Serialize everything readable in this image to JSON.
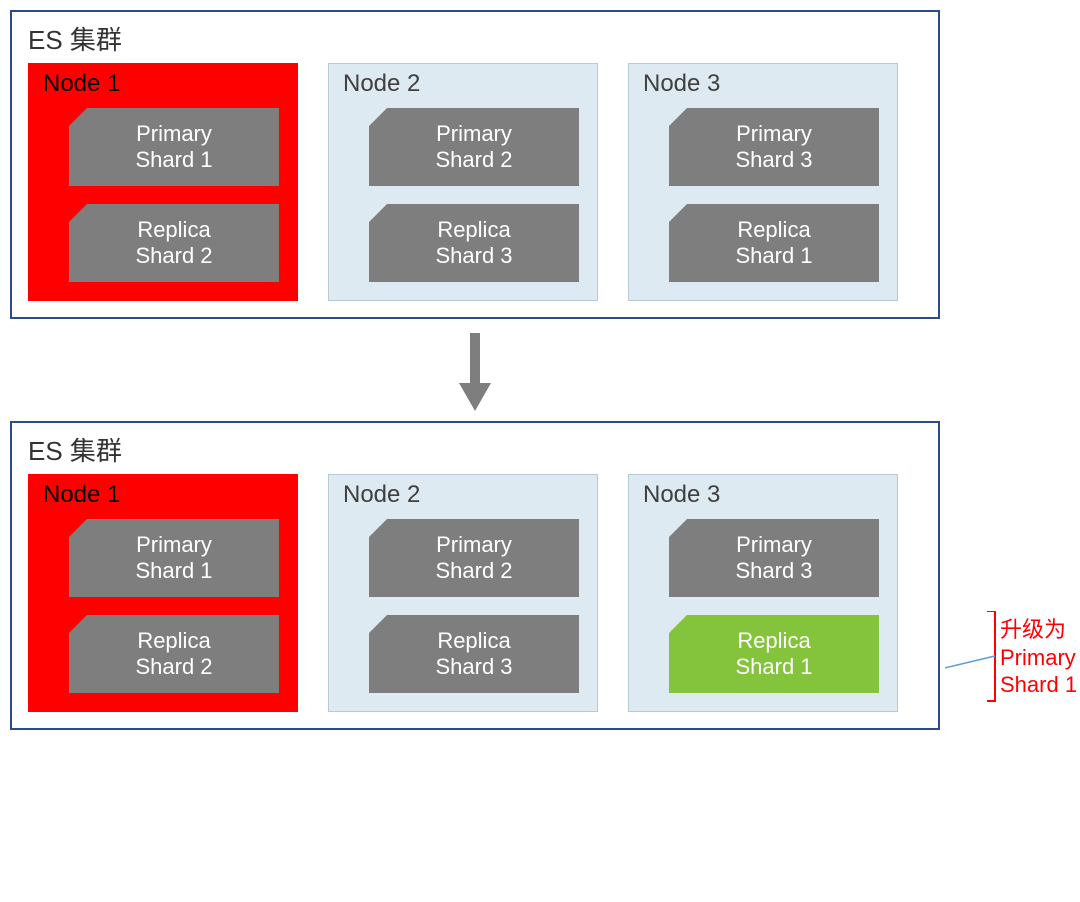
{
  "colors": {
    "border": "#2a4b8d",
    "node_blue": "#deeaf1",
    "node_red": "#fe0000",
    "shard_gray": "#7e7e7e",
    "shard_green": "#84c43c",
    "arrow": "#7e7e7e",
    "callout": "#fe0000"
  },
  "top": {
    "title": "ES 集群",
    "nodes": [
      {
        "name": "Node 1",
        "color": "red",
        "shards": [
          {
            "line1": "Primary",
            "line2": "Shard 1",
            "color": "gray"
          },
          {
            "line1": "Replica",
            "line2": "Shard 2",
            "color": "gray"
          }
        ]
      },
      {
        "name": "Node 2",
        "color": "blue",
        "shards": [
          {
            "line1": "Primary",
            "line2": "Shard 2",
            "color": "gray"
          },
          {
            "line1": "Replica",
            "line2": "Shard 3",
            "color": "gray"
          }
        ]
      },
      {
        "name": "Node 3",
        "color": "blue",
        "shards": [
          {
            "line1": "Primary",
            "line2": "Shard 3",
            "color": "gray"
          },
          {
            "line1": "Replica",
            "line2": "Shard 1",
            "color": "gray"
          }
        ]
      }
    ]
  },
  "bottom": {
    "title": "ES 集群",
    "nodes": [
      {
        "name": "Node 1",
        "color": "red",
        "shards": [
          {
            "line1": "Primary",
            "line2": "Shard 1",
            "color": "gray"
          },
          {
            "line1": "Replica",
            "line2": "Shard 2",
            "color": "gray"
          }
        ]
      },
      {
        "name": "Node 2",
        "color": "blue",
        "shards": [
          {
            "line1": "Primary",
            "line2": "Shard 2",
            "color": "gray"
          },
          {
            "line1": "Replica",
            "line2": "Shard 3",
            "color": "gray"
          }
        ]
      },
      {
        "name": "Node 3",
        "color": "blue",
        "shards": [
          {
            "line1": "Primary",
            "line2": "Shard 3",
            "color": "gray"
          },
          {
            "line1": "Replica",
            "line2": "Shard 1",
            "color": "green"
          }
        ]
      }
    ]
  },
  "callout": {
    "line1": "升级为",
    "line2": "Primary",
    "line3": "Shard 1"
  }
}
